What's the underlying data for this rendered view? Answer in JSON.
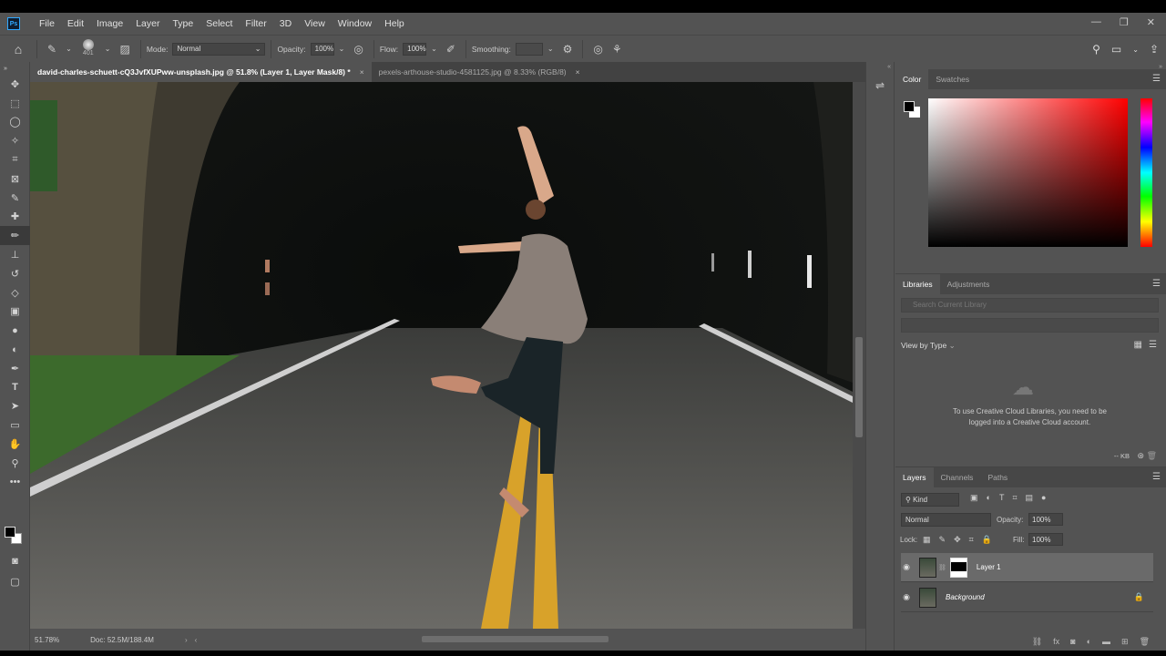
{
  "menu": {
    "logo": "Ps",
    "items": [
      "File",
      "Edit",
      "Image",
      "Layer",
      "Type",
      "Select",
      "Filter",
      "3D",
      "View",
      "Window",
      "Help"
    ],
    "window_controls": [
      "—",
      "❐",
      "✕"
    ]
  },
  "options": {
    "brush_size": "401",
    "mode_label": "Mode:",
    "mode_value": "Normal",
    "opacity_label": "Opacity:",
    "opacity_value": "100%",
    "flow_label": "Flow:",
    "flow_value": "100%",
    "smoothing_label": "Smoothing:",
    "smoothing_value": ""
  },
  "tabs": [
    {
      "label": "david-charles-schuett-cQ3JvfXUPww-unsplash.jpg @ 51.8% (Layer 1, Layer Mask/8) *",
      "close": "×"
    },
    {
      "label": "pexels-arthouse-studio-4581125.jpg @ 8.33% (RGB/8)",
      "close": "×"
    }
  ],
  "status": {
    "zoom": "51.78%",
    "doc": "Doc: 52.5M/188.4M"
  },
  "color_panel": {
    "tabs": [
      "Color",
      "Swatches"
    ]
  },
  "libraries_panel": {
    "tabs": [
      "Libraries",
      "Adjustments"
    ],
    "search_placeholder": "Search Current Library",
    "view_by": "View by Type",
    "message": "To use Creative Cloud Libraries, you need to be logged into a Creative Cloud account.",
    "size": "-- KB"
  },
  "layers_panel": {
    "tabs": [
      "Layers",
      "Channels",
      "Paths"
    ],
    "kind": "Kind",
    "blend_mode": "Normal",
    "opacity_label": "Opacity:",
    "opacity_value": "100%",
    "lock_label": "Lock:",
    "fill_label": "Fill:",
    "fill_value": "100%",
    "layers": [
      {
        "name": "Layer 1",
        "selected": true
      },
      {
        "name": "Background",
        "selected": false
      }
    ]
  },
  "colors": {
    "ui_bg": "#535353",
    "accent": "#31a8ff"
  }
}
